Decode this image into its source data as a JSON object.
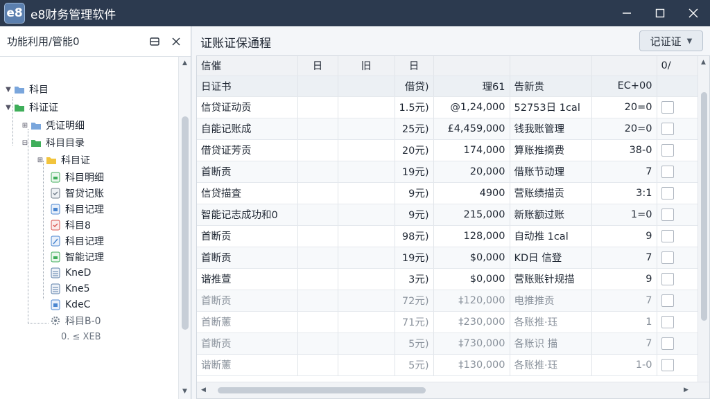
{
  "window": {
    "logo_text": "e8",
    "title": "e8财务管理软件",
    "controls": [
      "minimize",
      "maximize",
      "close"
    ]
  },
  "left_panel": {
    "title": "功能利用/管能0",
    "tree": [
      {
        "label": "科目",
        "icon": "folder-blue-icon",
        "level": 0,
        "expanded": true
      },
      {
        "label": "科证证",
        "icon": "folder-green-icon",
        "level": 0,
        "expanded": true
      },
      {
        "label": "凭证明细",
        "icon": "folder-blue-icon",
        "level": 1,
        "expanded": false
      },
      {
        "label": "科目目录",
        "icon": "folder-green-icon",
        "level": 1,
        "expanded": true
      },
      {
        "label": "科目证",
        "icon": "folder-yellow-icon",
        "level": 2,
        "expanded": false
      },
      {
        "label": "科目明细",
        "icon": "doc-green-icon",
        "level": 3
      },
      {
        "label": "智贷记账",
        "icon": "doc-check-icon",
        "level": 3
      },
      {
        "label": "科目记理",
        "icon": "doc-blue-icon",
        "level": 3
      },
      {
        "label": "科目8",
        "icon": "doc-red-icon",
        "level": 3
      },
      {
        "label": "科目记理",
        "icon": "doc-edit-icon",
        "level": 3
      },
      {
        "label": "智能记理",
        "icon": "doc-green-icon",
        "level": 3
      },
      {
        "label": "KneD",
        "icon": "list-icon",
        "level": 3
      },
      {
        "label": "Kne5",
        "icon": "list-icon",
        "level": 3
      },
      {
        "label": "KdeC",
        "icon": "doc-blue-icon",
        "level": 3
      },
      {
        "label": "科目B-0",
        "icon": "gear-icon",
        "level": 2
      },
      {
        "label": "0. ≤ XEB",
        "icon": "",
        "level": 3
      }
    ]
  },
  "main": {
    "title": "证账证保通程",
    "voucher_button": "记证证",
    "header_row1": [
      "信催",
      "日",
      "旧",
      "日",
      "",
      "",
      "",
      "0/"
    ],
    "header_row2": [
      "日证书",
      "",
      "",
      "借贷)",
      "理61",
      "告新贵",
      "EC+00",
      ""
    ],
    "rows": [
      [
        "信贷证动贡",
        "",
        "",
        "1.5元)",
        "@1,24,000",
        "52753日 1cal",
        "20=0"
      ],
      [
        "自能记账成",
        "",
        "",
        "25元)",
        "£4,459,000",
        "钱我账管理",
        "20=0"
      ],
      [
        "借贷证芳贡",
        "",
        "",
        "20元)",
        "174,000",
        "算账推摘费",
        "38-0"
      ],
      [
        "首断贡",
        "",
        "",
        "19元)",
        "20,000",
        "借账节动理",
        "7"
      ],
      [
        "信贷描査",
        "",
        "",
        "9元)",
        "4900",
        "营账绩描贡",
        "3:1"
      ],
      [
        "智能记志成功和0",
        "",
        "",
        "9元)",
        "215,000",
        "新账额过账",
        "1=0"
      ],
      [
        "首断贡",
        "",
        "",
        "98元)",
        "128,000",
        "自动推 1cal",
        "9"
      ],
      [
        "首断贡",
        "",
        "",
        "19元)",
        "$0,000",
        "KD日 信登",
        "7"
      ],
      [
        "谐推萱",
        "",
        "",
        "3元)",
        "$0,000",
        "营账账针规描",
        "9"
      ],
      [
        "首断贡",
        "",
        "",
        "72元)",
        "‡120,000",
        "电推推贡",
        "7"
      ],
      [
        "首断藼",
        "",
        "",
        "71元)",
        "‡230,000",
        "各账推·珏",
        "1"
      ],
      [
        "首断贡",
        "",
        "",
        "5元)",
        "‡730,000",
        "各账识 描",
        "7"
      ],
      [
        "谐断藼",
        "",
        "",
        "5元)",
        "‡130,000",
        "各账推·珏",
        "1-0"
      ]
    ]
  },
  "colors": {
    "titlebar": "#2c3a4f",
    "folder_blue": "#7aa6dc",
    "folder_green": "#3fae5a",
    "folder_yellow": "#f2c43d",
    "accent_red": "#d9534f"
  }
}
